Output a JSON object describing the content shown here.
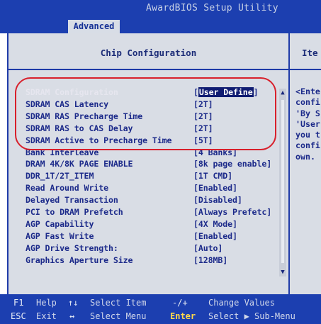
{
  "app_title": "AwardBIOS Setup Utility",
  "tab": "Advanced",
  "section_title": "Chip Configuration",
  "help_title": "Ite",
  "settings": [
    {
      "label": "SDRAM Configuration",
      "value": "[User Define]",
      "selected": true
    },
    {
      "label": "SDRAM CAS Latency",
      "value": "[2T]"
    },
    {
      "label": "SDRAM RAS Precharge Time",
      "value": "[2T]"
    },
    {
      "label": "SDRAM RAS to CAS Delay",
      "value": "[2T]"
    },
    {
      "label": "SDRAM Active to Precharge Time",
      "value": "[5T]"
    },
    {
      "label": "Bank Interleave",
      "value": "[4 Banks]"
    },
    {
      "label": "DRAM 4K/8K PAGE ENABLE",
      "value": "[8k page enable]"
    },
    {
      "label": "DDR_1T/2T_ITEM",
      "value": "[1T CMD]"
    },
    {
      "label": "Read Around Write",
      "value": "[Enabled]"
    },
    {
      "label": "Delayed Transaction",
      "value": "[Disabled]"
    },
    {
      "label": "PCI to DRAM Prefetch",
      "value": "[Always Prefetc]"
    },
    {
      "label": "AGP Capability",
      "value": "[4X Mode]"
    },
    {
      "label": "AGP Fast Write",
      "value": "[Enabled]"
    },
    {
      "label": "AGP Drive Strength:",
      "value": "[Auto]"
    },
    {
      "label": "Graphics Aperture Size",
      "value": "[128MB]"
    }
  ],
  "help_lines": [
    "<Ente",
    "confi",
    "'By S",
    "'User",
    "you t",
    "confi",
    "own."
  ],
  "footer": {
    "row1": {
      "k1": "F1",
      "d1": "Help",
      "s1": "↑↓",
      "d2": "Select Item",
      "s2": "-/+",
      "d3": "Change Values"
    },
    "row2": {
      "k1": "ESC",
      "d1": "Exit",
      "s1": "↔",
      "d2": "Select Menu",
      "k2": "Enter",
      "d3": "Select ▶ Sub-Menu"
    }
  },
  "colors": {
    "bios_blue": "#1c3fb0",
    "panel_gray": "#d9dde5",
    "text_blue": "#1c2a8a",
    "highlight_ring": "#d8202c"
  }
}
